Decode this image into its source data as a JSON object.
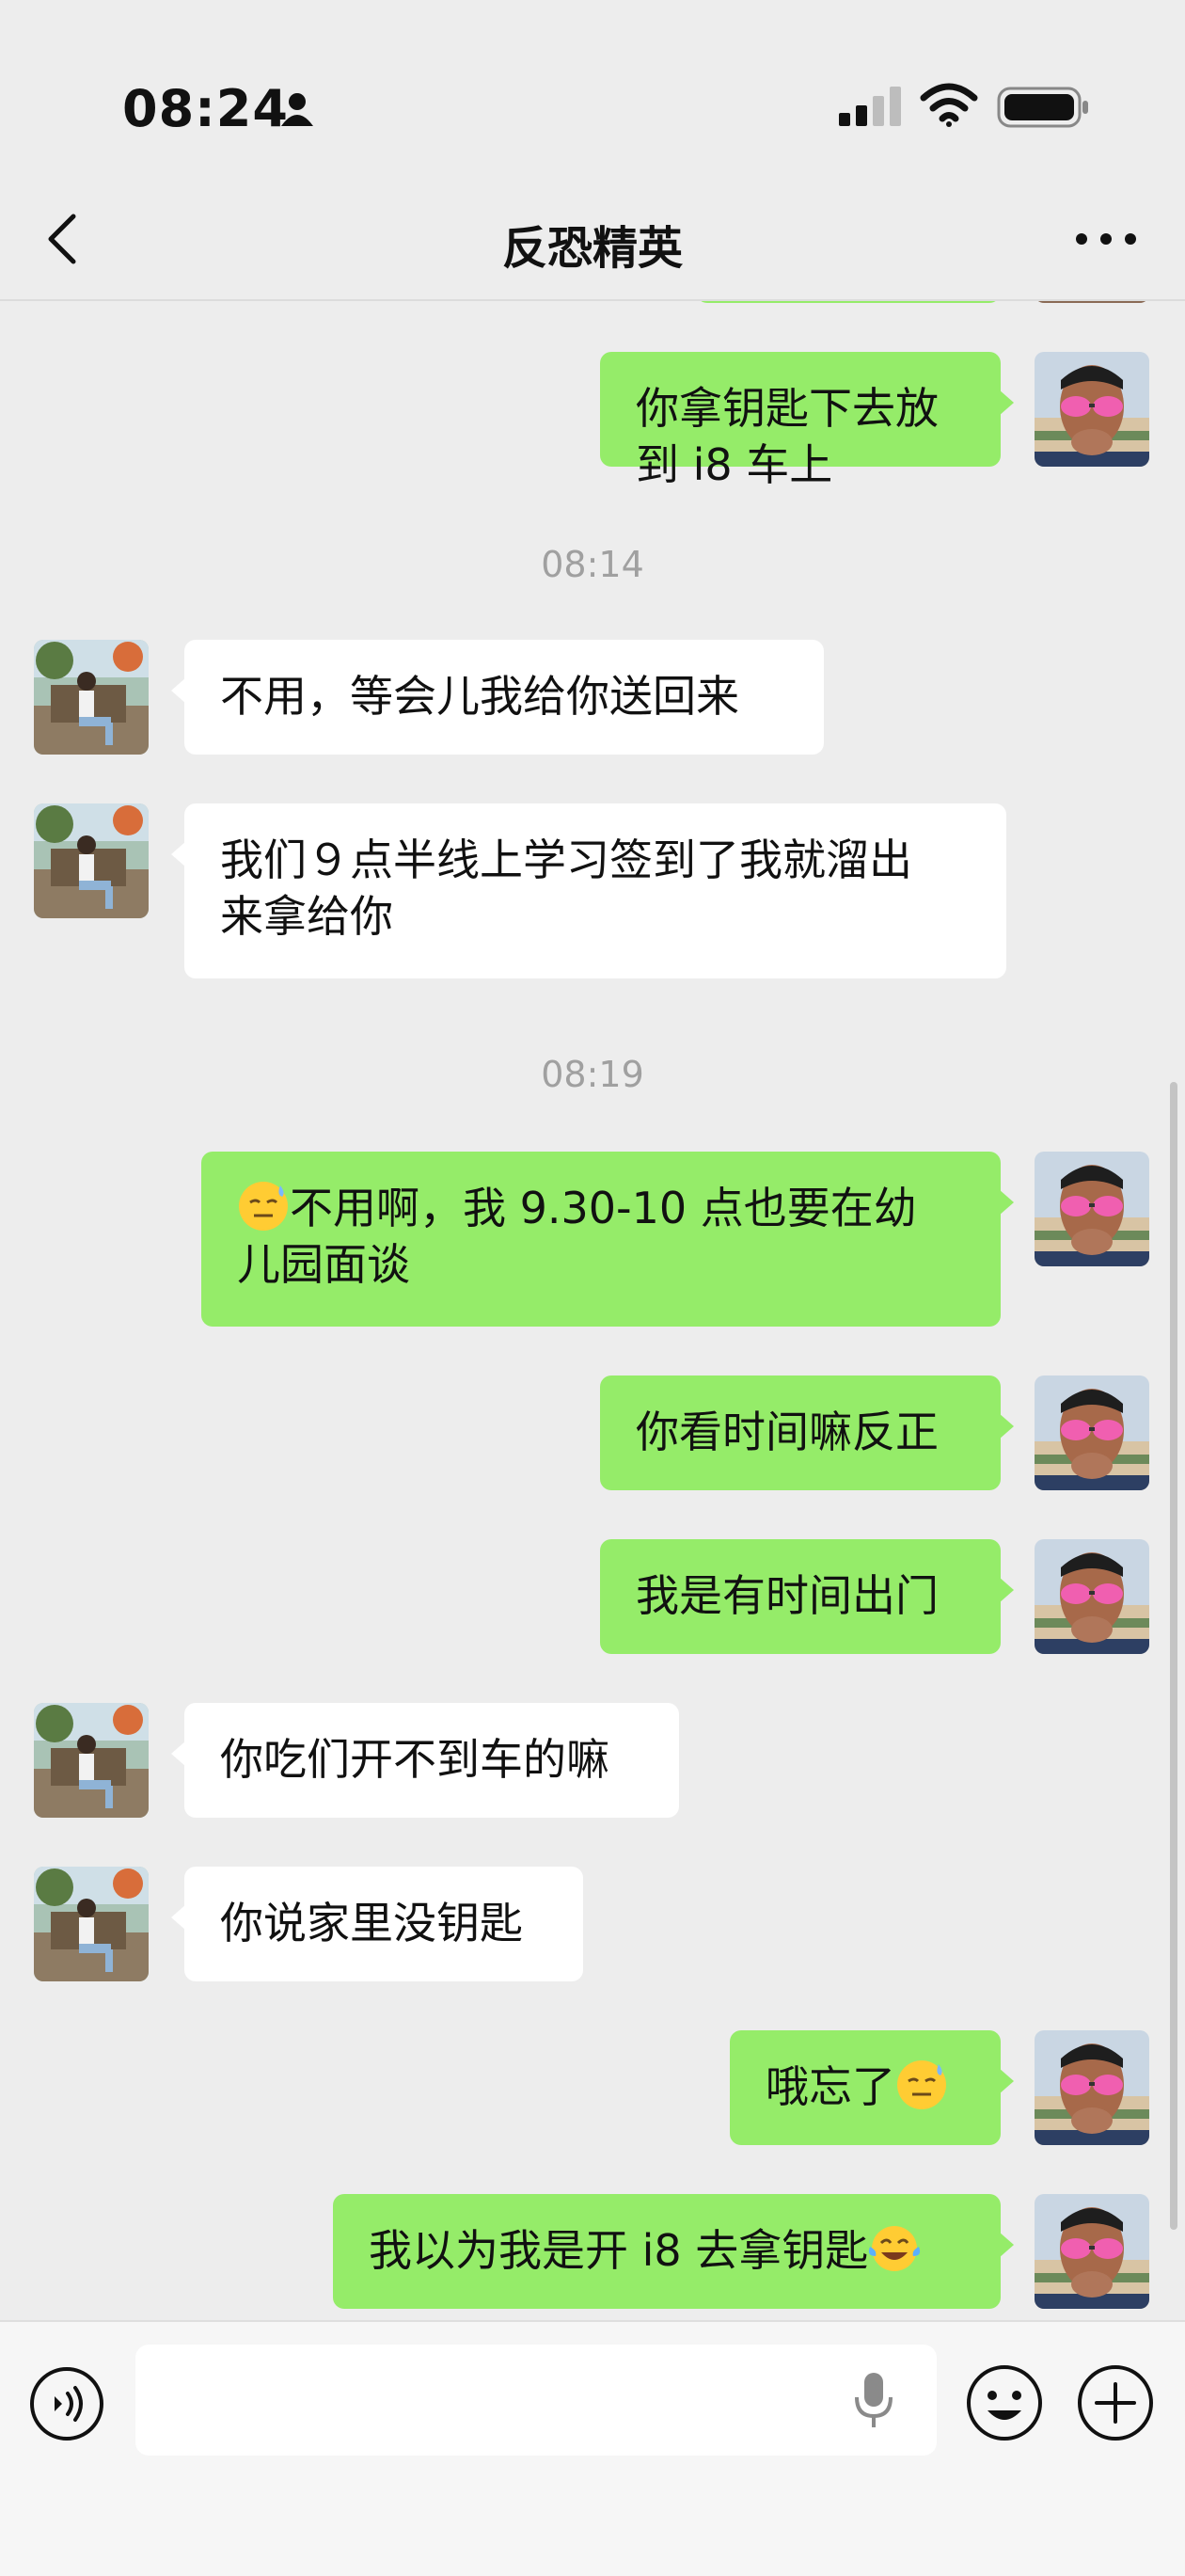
{
  "status_bar": {
    "time": "08:24"
  },
  "header": {
    "title": "反恐精英"
  },
  "messages": [
    {
      "text": "你拿钥匙下去放到 i8 车上"
    },
    {
      "timestamp": "08:14"
    },
    {
      "text": "不用，等会儿我给你送回来"
    },
    {
      "text": "我们９点半线上学习签到了我就溜出\n来拿给你"
    },
    {
      "timestamp": "08:19"
    },
    {
      "text": "不用啊，我 9.30-10 点也要在幼\n儿园面谈",
      "emoji": "sweat-smile-face"
    },
    {
      "text": "你看时间嘛反正"
    },
    {
      "text": "我是有时间出门"
    },
    {
      "text": "你吃们开不到车的嘛"
    },
    {
      "text": "你说家里没钥匙"
    },
    {
      "text": "哦忘了",
      "emoji": "sweat-smile-face"
    },
    {
      "text": "我以为我是开 i8 去拿钥匙",
      "emoji": "tears-of-joy-face"
    }
  ],
  "input": {
    "placeholder": ""
  },
  "colors": {
    "sent_bubble": "#95ec69",
    "received_bubble": "#ffffff",
    "background": "#ededed"
  }
}
